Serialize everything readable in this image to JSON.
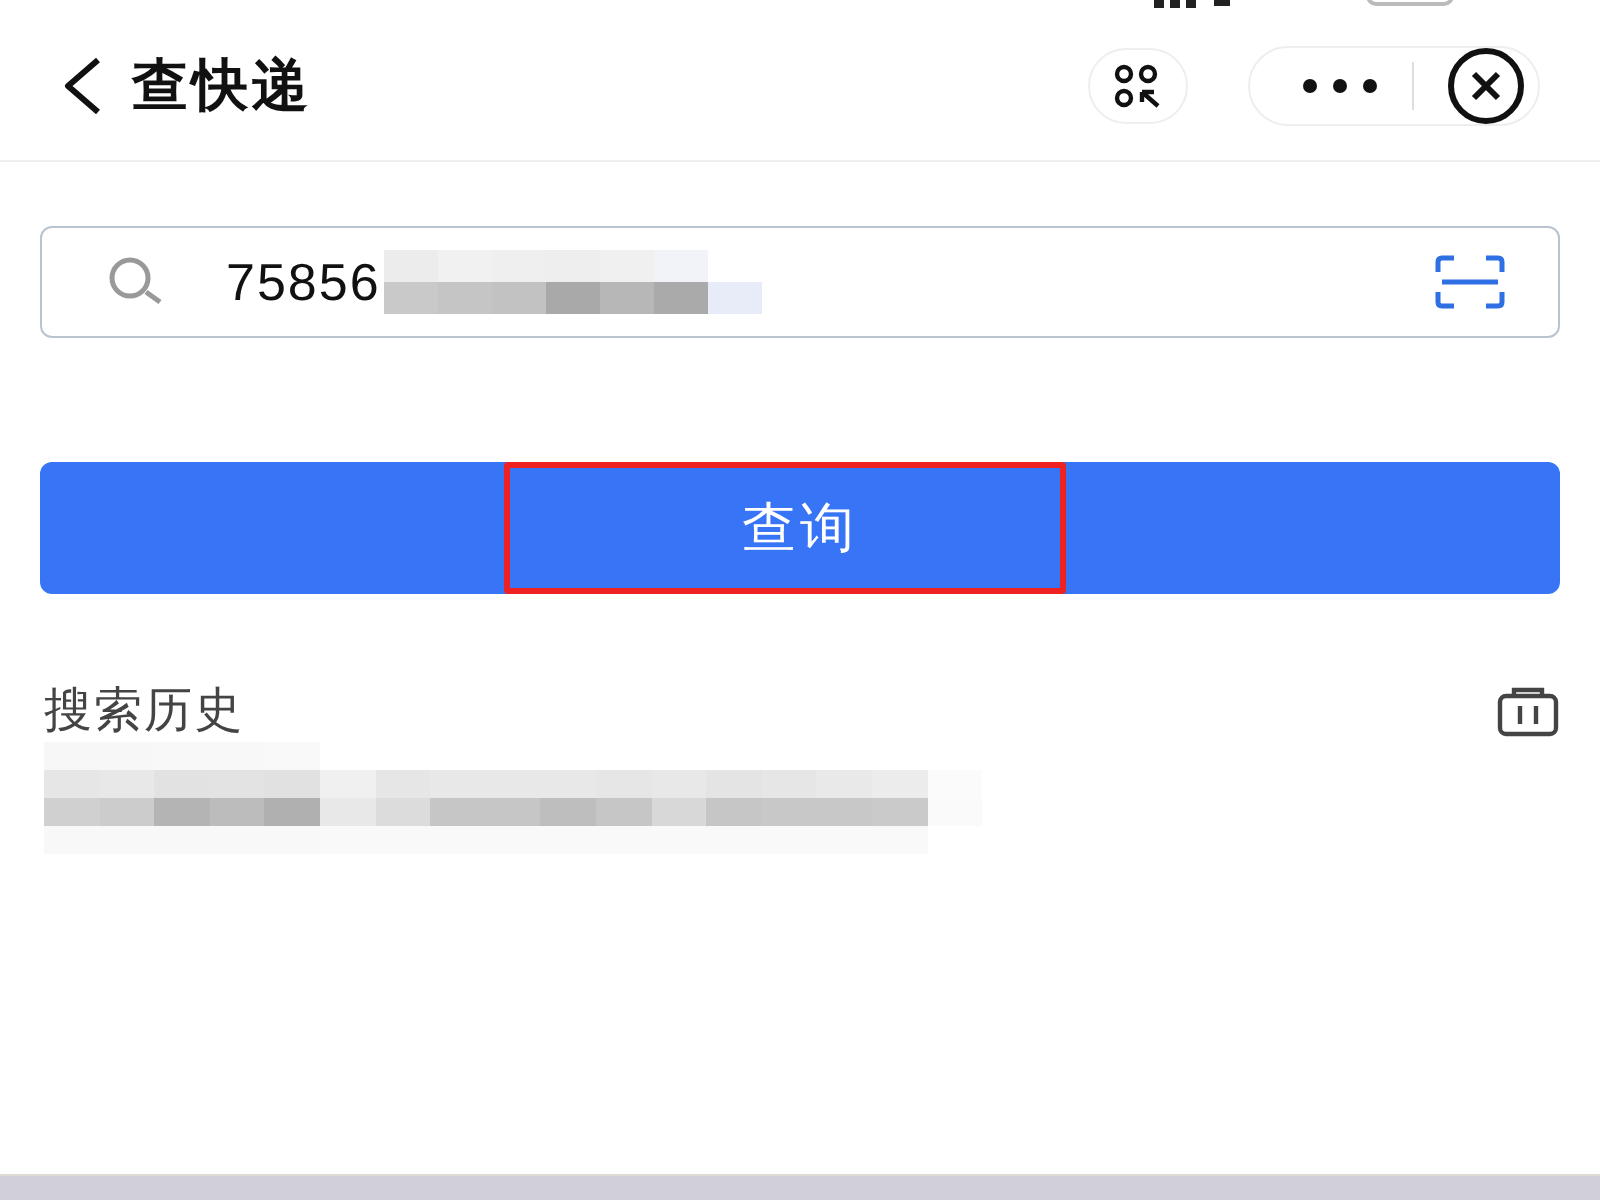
{
  "nav": {
    "title": "查快递"
  },
  "search": {
    "value": "75856",
    "value_redacted": true
  },
  "query_button": {
    "label": "查询",
    "highlighted": true
  },
  "history": {
    "title": "搜索历史",
    "items": [
      {
        "kind": "redacted"
      }
    ]
  }
}
